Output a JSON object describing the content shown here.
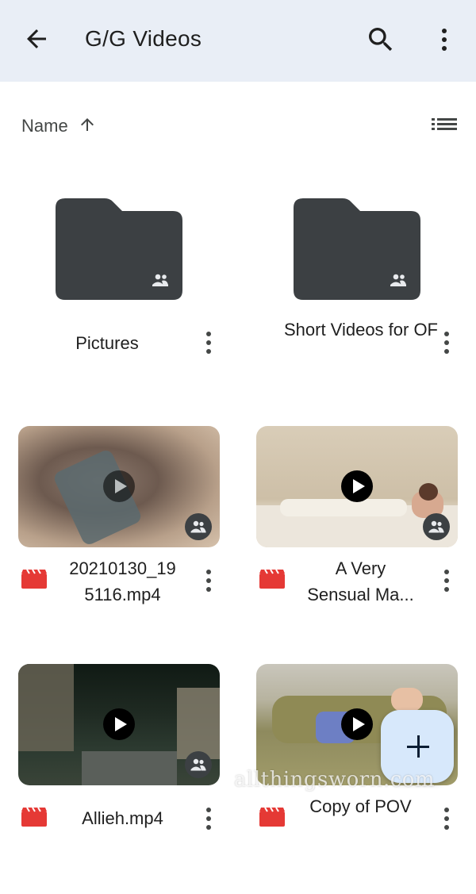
{
  "appbar": {
    "title": "G/G Videos",
    "back_icon": "arrow-back-icon",
    "search_icon": "search-icon",
    "more_icon": "more-vert-icon"
  },
  "sort": {
    "label": "Name",
    "direction_icon": "arrow-up-icon",
    "view_icon": "list-view-icon"
  },
  "folders": [
    {
      "name": "Pictures",
      "shared": true
    },
    {
      "name": "Short Videos for OF",
      "shared": true
    }
  ],
  "files": [
    {
      "name": "20210130_195116.mp4",
      "display": [
        "20210130_19",
        "5116.mp4"
      ],
      "type": "video",
      "shared": true
    },
    {
      "name": "A Very Sensual Ma...",
      "display": [
        "A Very",
        "Sensual Ma..."
      ],
      "type": "video",
      "shared": true
    },
    {
      "name": "Allieh.mp4",
      "display": [
        "Allieh.mp4"
      ],
      "type": "video",
      "shared": true
    },
    {
      "name": "Copy of POV",
      "display": [
        "Copy of POV"
      ],
      "type": "video",
      "shared": true
    }
  ],
  "fab": {
    "icon": "plus-icon"
  },
  "watermark": "allthingsworn.com",
  "colors": {
    "appbar_bg": "#e9eef6",
    "folder": "#3c4043",
    "video_type_icon": "#e53935",
    "fab_bg": "#d7e8fb"
  }
}
